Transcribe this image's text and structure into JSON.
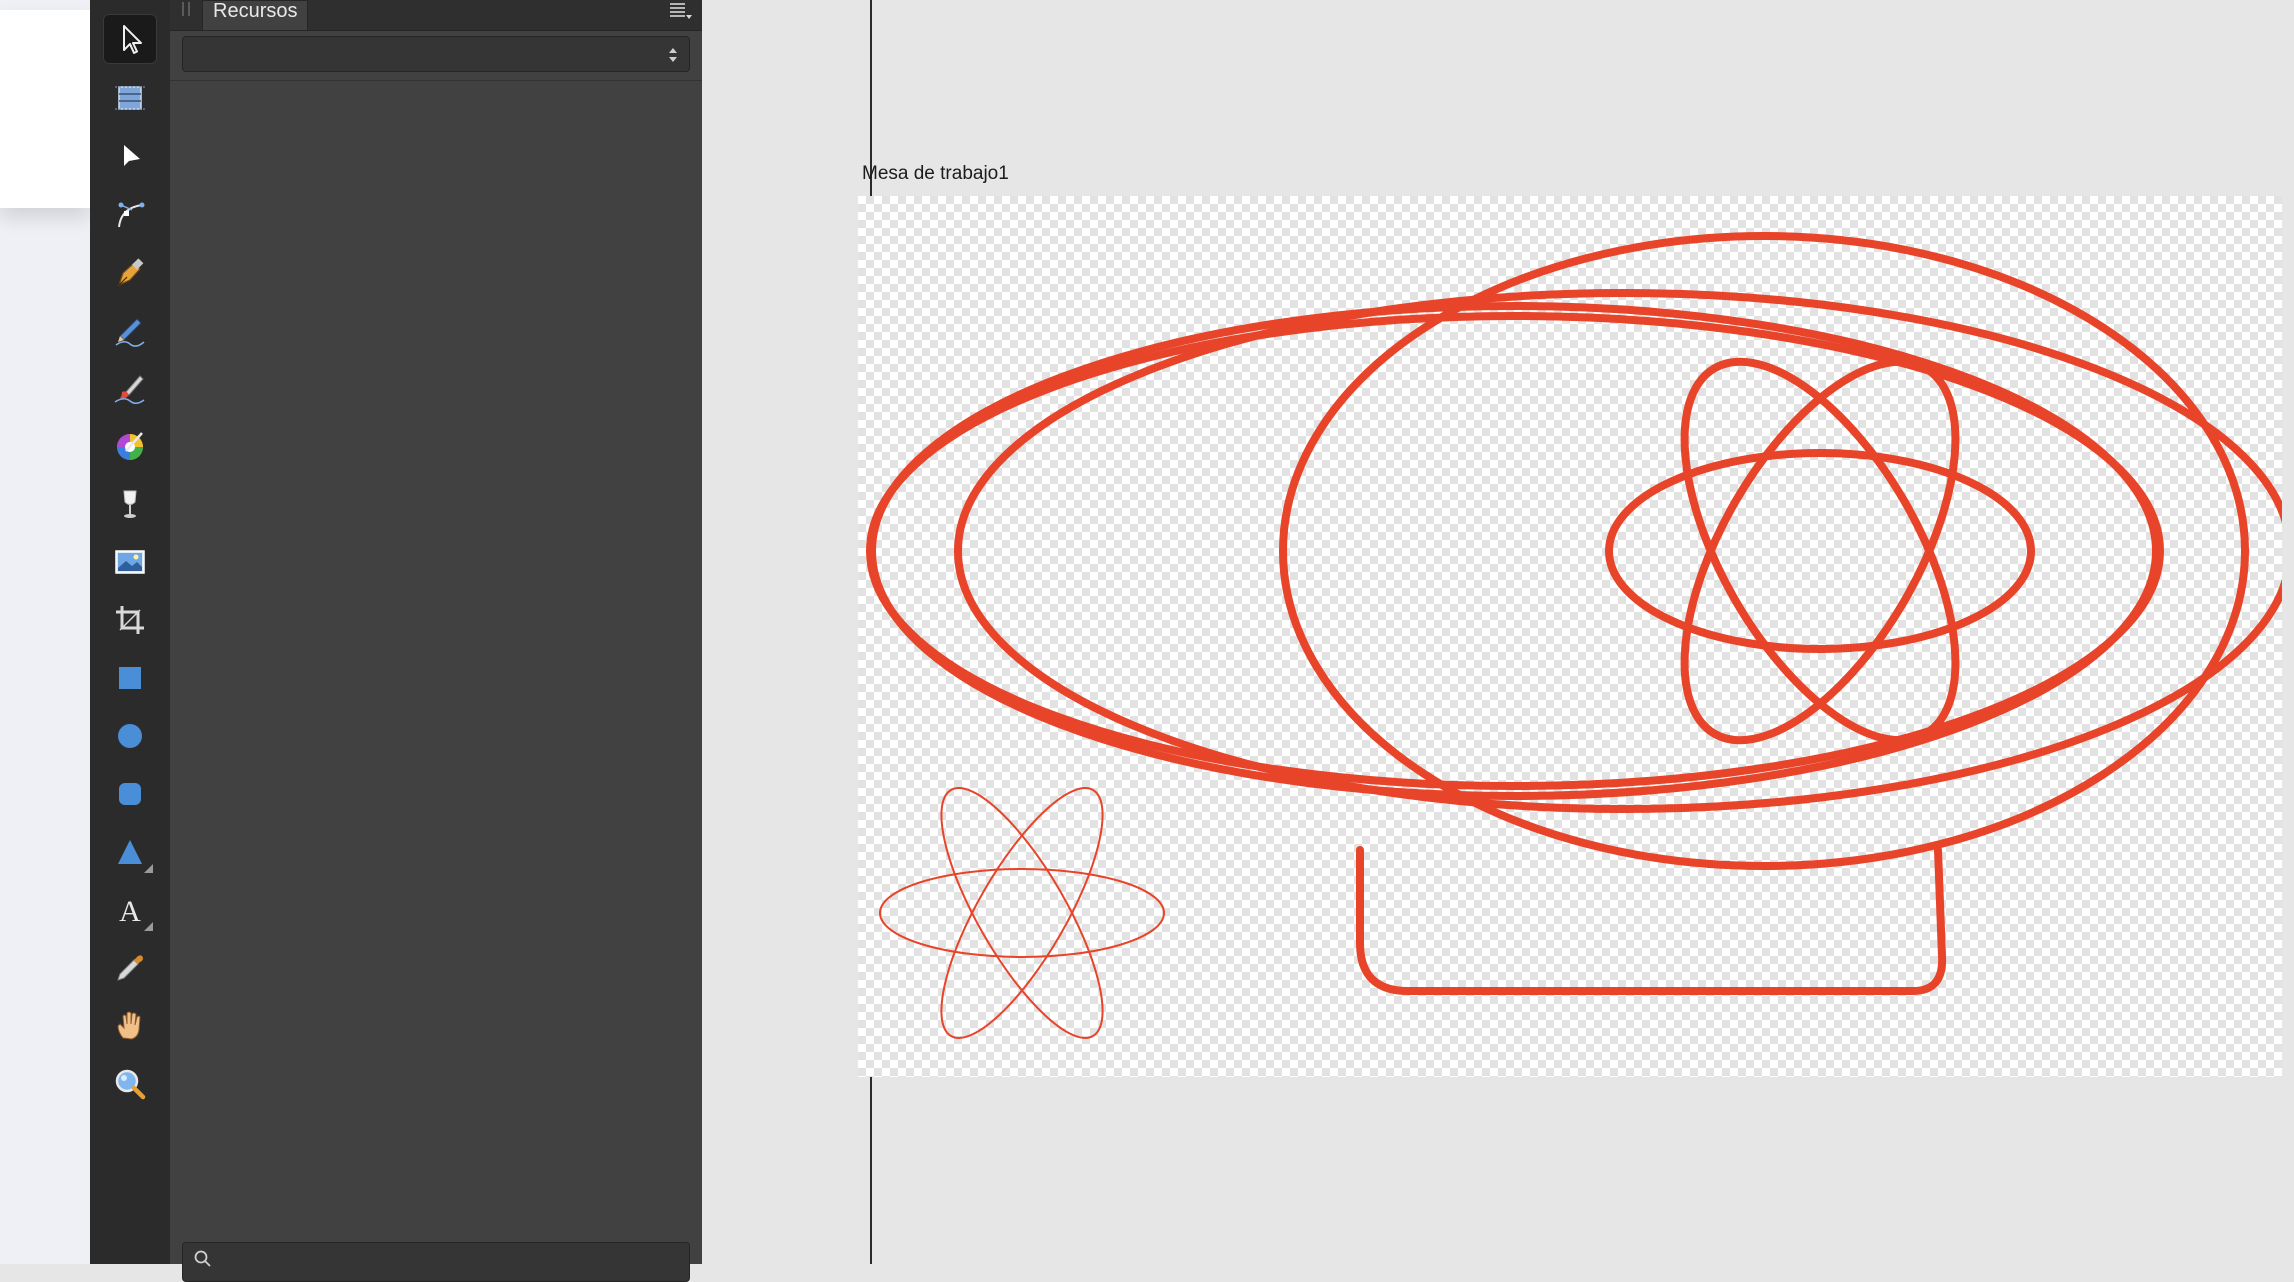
{
  "panel": {
    "tab_label": "Recursos",
    "select_value": "",
    "search_placeholder": ""
  },
  "toolbar": {
    "tools": [
      {
        "name": "move-tool",
        "icon": "pointer-arrow-icon",
        "selected": true
      },
      {
        "name": "artboard-tool",
        "icon": "artboard-icon"
      },
      {
        "name": "node-tool",
        "icon": "black-arrow-icon"
      },
      {
        "name": "corner-tool",
        "icon": "curve-node-icon"
      },
      {
        "name": "pen-tool",
        "icon": "pen-nib-icon"
      },
      {
        "name": "pencil-tool",
        "icon": "pencil-icon"
      },
      {
        "name": "vector-brush-tool",
        "icon": "brush-icon"
      },
      {
        "name": "fill-tool",
        "icon": "color-wheel-icon"
      },
      {
        "name": "transparency-tool",
        "icon": "wine-glass-icon"
      },
      {
        "name": "place-image-tool",
        "icon": "image-icon"
      },
      {
        "name": "crop-tool",
        "icon": "crop-icon"
      },
      {
        "name": "rectangle-tool",
        "icon": "square-shape-icon"
      },
      {
        "name": "ellipse-tool",
        "icon": "circle-shape-icon"
      },
      {
        "name": "rounded-rectangle-tool",
        "icon": "rounded-square-icon"
      },
      {
        "name": "triangle-tool",
        "icon": "triangle-icon"
      },
      {
        "name": "text-tool",
        "icon": "text-icon"
      },
      {
        "name": "color-picker-tool",
        "icon": "eyedropper-icon"
      },
      {
        "name": "view-tool",
        "icon": "hand-icon"
      },
      {
        "name": "zoom-tool",
        "icon": "magnifier-icon"
      }
    ]
  },
  "canvas": {
    "artboard_label": "Mesa de trabajo1",
    "stroke_color": "#e8442a",
    "background": "#e6e6e6"
  },
  "colors": {
    "toolbar_bg": "#2b2b2b",
    "panel_bg": "#414141",
    "tool_blue": "#4a8ed8"
  }
}
